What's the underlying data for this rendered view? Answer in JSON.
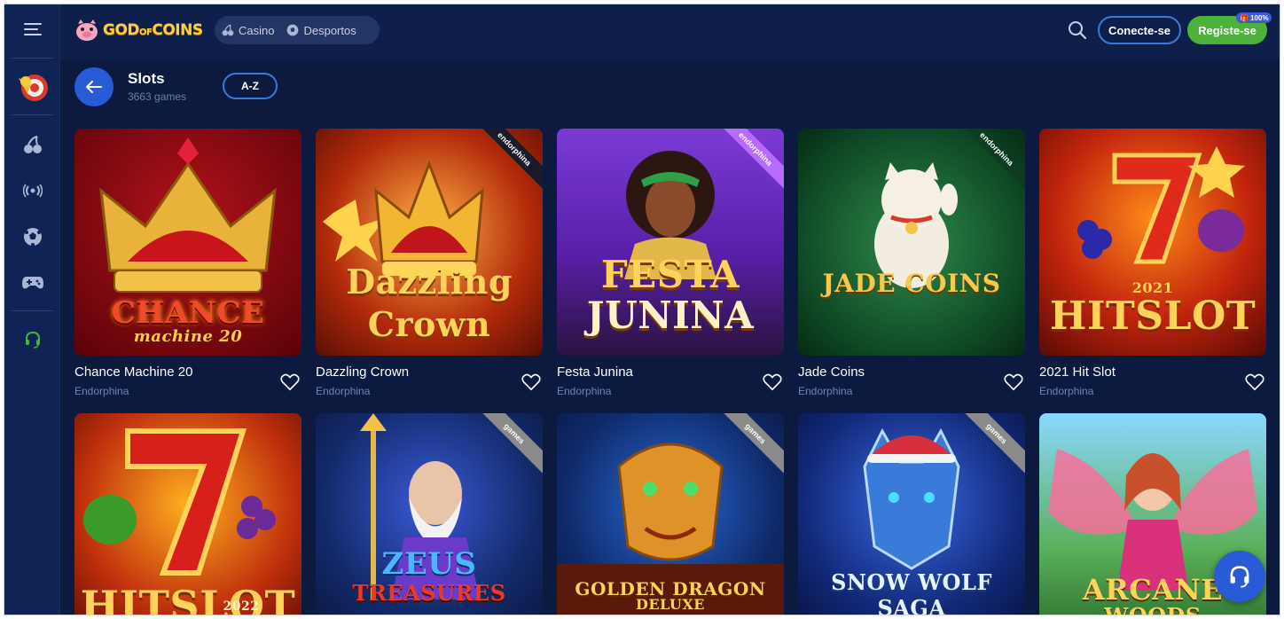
{
  "brand": {
    "logo_text": "GOD OF COINS"
  },
  "nav": {
    "items": [
      {
        "label": "Casino",
        "icon": "cherry-icon"
      },
      {
        "label": "Desportos",
        "icon": "soccer-ball-icon"
      }
    ]
  },
  "auth": {
    "login_label": "Conecte-se",
    "register_label": "Registe-se",
    "register_badge": "100%"
  },
  "sidebar": {
    "items": [
      "menu-icon",
      "promo-wheel-icon",
      "cherry-icon",
      "live-signal-icon",
      "soccer-ball-icon",
      "gamepad-icon",
      "headset-icon"
    ]
  },
  "section": {
    "title": "Slots",
    "count": "3663 games",
    "sort_label": "A-Z"
  },
  "games": [
    {
      "name": "Chance Machine 20",
      "provider": "Endorphina",
      "art_text": "CHANCE",
      "art_sub": "machine 20",
      "corner": ""
    },
    {
      "name": "Dazzling Crown",
      "provider": "Endorphina",
      "art_text": "Dazzling",
      "art_sub": "Crown",
      "corner": "endorphina"
    },
    {
      "name": "Festa Junina",
      "provider": "Endorphina",
      "art_text": "FESTA",
      "art_sub": "JUNINA",
      "corner": "endorphina"
    },
    {
      "name": "Jade Coins",
      "provider": "Endorphina",
      "art_text": "JADE COINS",
      "art_sub": "",
      "corner": "endorphina"
    },
    {
      "name": "2021 Hit Slot",
      "provider": "Endorphina",
      "art_text": "HITSLOT",
      "art_sub": "2021",
      "corner": ""
    },
    {
      "name": "",
      "provider": "",
      "art_text": "HITSLOT",
      "art_sub": "2022",
      "corner": ""
    },
    {
      "name": "",
      "provider": "",
      "art_text": "ZEUS",
      "art_sub": "TREASURES",
      "corner": "games"
    },
    {
      "name": "",
      "provider": "",
      "art_text": "GOLDEN DRAGON",
      "art_sub": "DELUXE",
      "corner": "games"
    },
    {
      "name": "",
      "provider": "",
      "art_text": "SNOW WOLF SAGA",
      "art_sub": "",
      "corner": "games"
    },
    {
      "name": "",
      "provider": "",
      "art_text": "ARCANE",
      "art_sub": "WOODS",
      "corner": ""
    }
  ],
  "colors": {
    "background": "#0b1a3e",
    "accent_blue": "#2a5bd7",
    "register_green": "#4cb33a"
  }
}
